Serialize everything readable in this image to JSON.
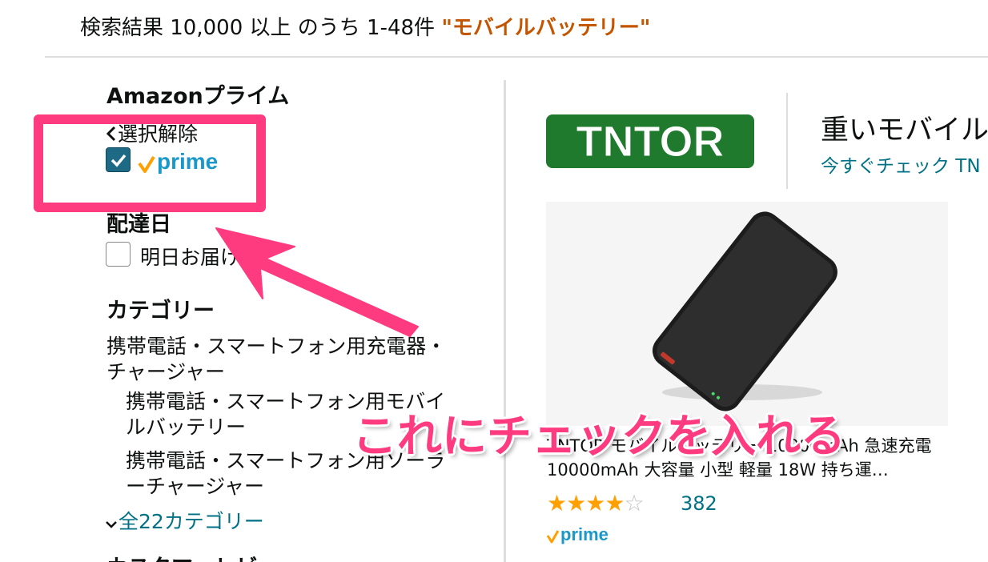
{
  "search": {
    "result_count": "検索結果 10,000 以上 のうち 1-48件 ",
    "query": "\"モバイルバッテリー\""
  },
  "sidebar": {
    "prime_heading": "Amazonプライム",
    "clear_selection": "選択解除",
    "prime_checked": true,
    "prime_logo_text": "prime",
    "delivery_heading": "配達日",
    "delivery_option": "明日お届け",
    "category_heading": "カテゴリー",
    "categories": [
      {
        "line1": "携帯電話・スマートフォン用充電器・",
        "line2": "チャージャー"
      },
      {
        "line1": "携帯電話・スマートフォン用モバイ",
        "line2": "ルバッテリー"
      },
      {
        "line1": "携帯電話・スマートフォン用ソーラ",
        "line2": "ーチャージャー"
      }
    ],
    "all_categories": "全22カテゴリー",
    "next_heading": "カスタマーレビュー"
  },
  "brand": {
    "logo_text": "TNTOR",
    "headline": "重いモバイル",
    "link": "今すぐチェック TN"
  },
  "product": {
    "title_line1": "TNTOR モバイルバッテリー 10000mAh 急速充電",
    "title_line2": "10000mAh 大容量 小型 軽量 18W 持ち運…",
    "rating": 4,
    "rating_count": "382",
    "prime_text": "prime"
  },
  "annotation": {
    "text": "これにチェックを入れる"
  },
  "colors": {
    "accent_pink": "#ff3b80",
    "link_teal": "#007185",
    "query_orange": "#c45500",
    "star_orange": "#ff9f00",
    "tntor_green": "#1f7a2e",
    "prime_blue": "#1a98c9",
    "checkbox_blue": "#1e6a85"
  },
  "icons": {
    "back": "chevron-left-icon",
    "check": "checkmark-icon",
    "expand": "chevron-down-icon"
  }
}
